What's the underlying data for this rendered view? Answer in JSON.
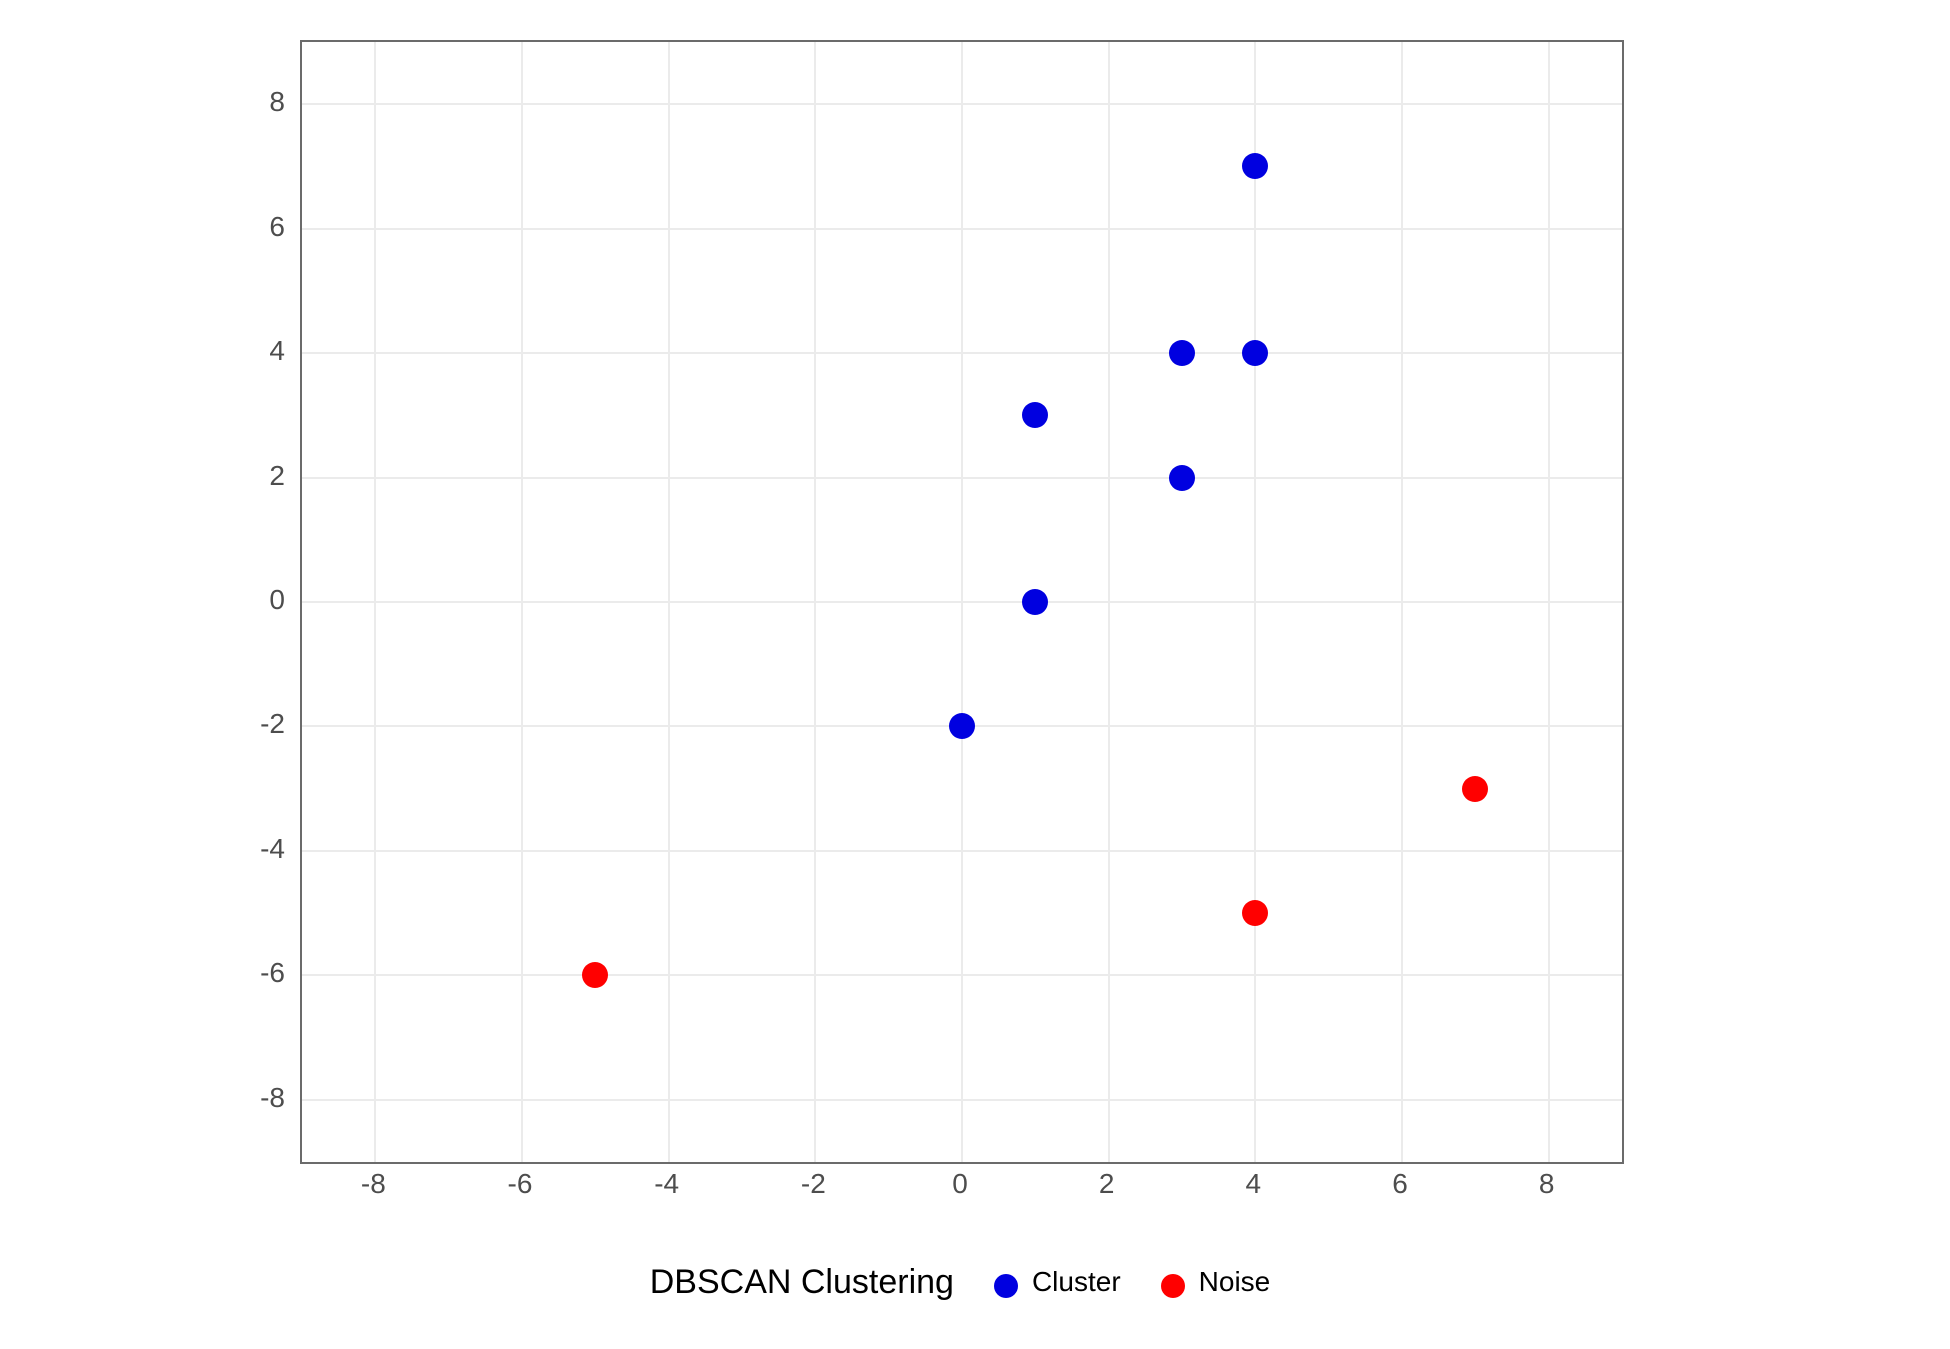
{
  "chart_data": {
    "type": "scatter",
    "title": "",
    "xlabel": "",
    "ylabel": "",
    "xlim": [
      -9,
      9
    ],
    "ylim": [
      -9,
      9
    ],
    "x_ticks": [
      -8,
      -6,
      -4,
      -2,
      0,
      2,
      4,
      6,
      8
    ],
    "y_ticks": [
      -8,
      -6,
      -4,
      -2,
      0,
      2,
      4,
      6,
      8
    ],
    "series": [
      {
        "name": "Cluster",
        "color": "#0000e0",
        "points": [
          {
            "x": 4,
            "y": 7
          },
          {
            "x": 3,
            "y": 4
          },
          {
            "x": 4,
            "y": 4
          },
          {
            "x": 1,
            "y": 3
          },
          {
            "x": 3,
            "y": 2
          },
          {
            "x": 1,
            "y": 0
          },
          {
            "x": 0,
            "y": -2
          }
        ]
      },
      {
        "name": "Noise",
        "color": "#ff0000",
        "points": [
          {
            "x": 7,
            "y": -3
          },
          {
            "x": 4,
            "y": -5
          },
          {
            "x": -5,
            "y": -6
          }
        ]
      }
    ],
    "legend_title": "DBSCAN Clustering"
  },
  "legend": {
    "title": "DBSCAN Clustering",
    "items": [
      {
        "label": "Cluster",
        "color": "blue"
      },
      {
        "label": "Noise",
        "color": "red"
      }
    ]
  }
}
